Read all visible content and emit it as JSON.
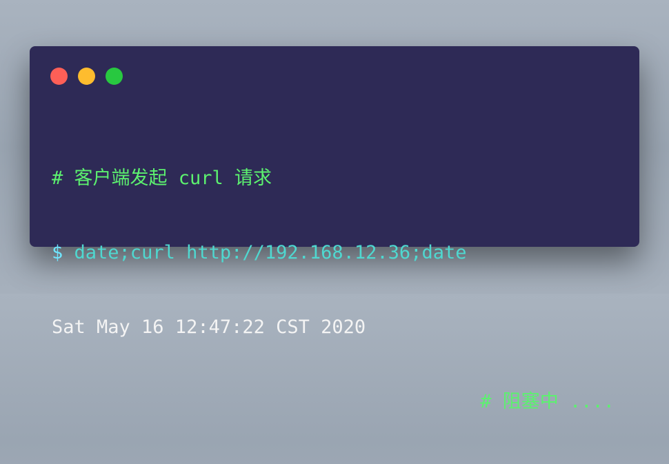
{
  "terminal": {
    "lines": {
      "comment1": "# 客户端发起 curl 请求",
      "prompt": "$",
      "command": "date;curl http://192.168.12.36;date",
      "output": "Sat May 16 12:47:22 CST 2020",
      "comment2": "# 阻塞中 ...."
    }
  },
  "colors": {
    "background": "#2e2a56",
    "comment": "#5cf16f",
    "command": "#4fd8d0",
    "output": "#f4f4f4",
    "close": "#fe5f57",
    "minimize": "#febc2e",
    "maximize": "#28c840"
  }
}
